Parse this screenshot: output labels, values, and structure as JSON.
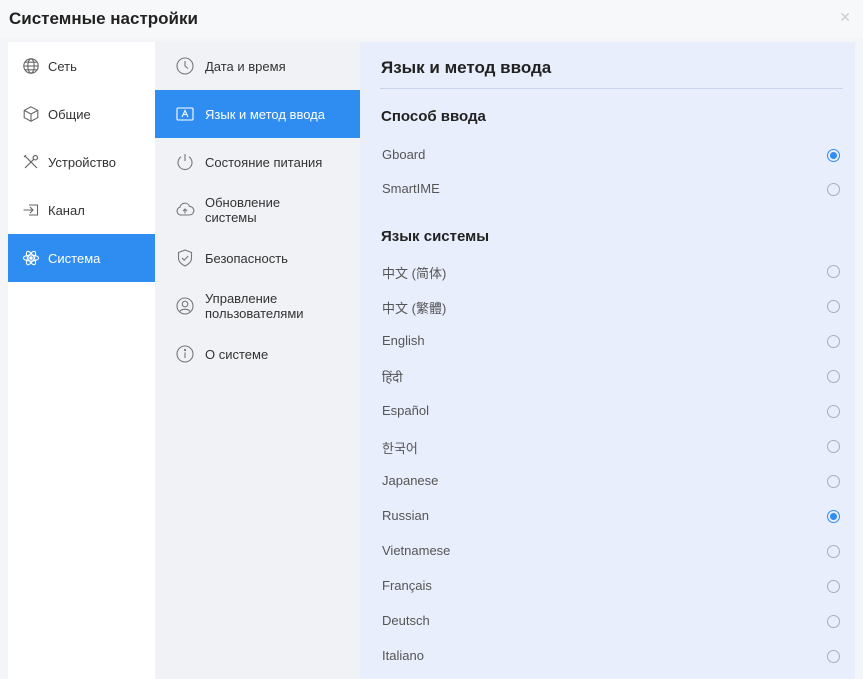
{
  "window": {
    "title": "Системные настройки",
    "close_glyph": "✕"
  },
  "nav1": {
    "items": [
      {
        "label": "Сеть",
        "icon": "globe-icon"
      },
      {
        "label": "Общие",
        "icon": "cube-icon"
      },
      {
        "label": "Устройство",
        "icon": "tools-icon"
      },
      {
        "label": "Канал",
        "icon": "input-icon"
      },
      {
        "label": "Система",
        "icon": "atom-icon",
        "active": true
      }
    ]
  },
  "nav2": {
    "items": [
      {
        "label": "Дата и время",
        "icon": "clock-icon"
      },
      {
        "label": "Язык и метод ввода",
        "icon": "keyboard-a-icon",
        "active": true
      },
      {
        "label": "Состояние питания",
        "icon": "power-icon"
      },
      {
        "label_line1": "Обновление",
        "label_line2": "системы",
        "icon": "cloud-upload-icon"
      },
      {
        "label": "Безопасность",
        "icon": "shield-check-icon"
      },
      {
        "label_line1": "Управление",
        "label_line2": "пользователями",
        "icon": "user-icon"
      },
      {
        "label": "О системе",
        "icon": "info-icon"
      }
    ]
  },
  "panel": {
    "title": "Язык и метод ввода",
    "input_section": "Способ ввода",
    "input_methods": [
      {
        "label": "Gboard",
        "selected": true
      },
      {
        "label": "SmartIME",
        "selected": false
      }
    ],
    "language_section": "Язык системы",
    "languages": [
      {
        "label": "中文 (简体)",
        "selected": false
      },
      {
        "label": "中文 (繁體)",
        "selected": false
      },
      {
        "label": "English",
        "selected": false
      },
      {
        "label": "हिंदी",
        "selected": false
      },
      {
        "label": "Español",
        "selected": false
      },
      {
        "label": "한국어",
        "selected": false
      },
      {
        "label": "Japanese",
        "selected": false
      },
      {
        "label": "Russian",
        "selected": true
      },
      {
        "label": "Vietnamese",
        "selected": false
      },
      {
        "label": "Français",
        "selected": false
      },
      {
        "label": "Deutsch",
        "selected": false
      },
      {
        "label": "Italiano",
        "selected": false
      }
    ]
  },
  "colors": {
    "accent": "#2f8cf0",
    "panel_bg": "#e9eefc"
  }
}
